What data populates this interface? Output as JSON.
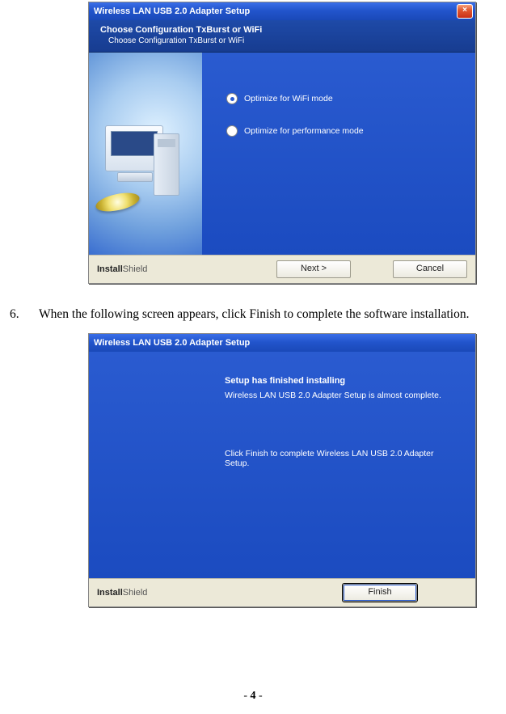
{
  "dialog1": {
    "title": "Wireless LAN USB 2.0 Adapter Setup",
    "header_title": "Choose Configuration TxBurst or WiFi",
    "header_sub": "Choose Configuration TxBurst or WiFi",
    "option1": "Optimize for WiFi mode",
    "option2": "Optimize for performance mode",
    "brand_a": "Install",
    "brand_b": "Shield",
    "next": "Next >",
    "cancel": "Cancel"
  },
  "step": {
    "number": "6.",
    "text": "When the following screen appears, click Finish to complete the software installation."
  },
  "dialog2": {
    "title": "Wireless LAN USB 2.0 Adapter Setup",
    "h1": "Setup has finished installing",
    "line1": "Wireless LAN USB 2.0 Adapter Setup is almost complete.",
    "line2": "Click Finish to complete Wireless LAN USB 2.0 Adapter Setup.",
    "brand_a": "Install",
    "brand_b": "Shield",
    "finish": "Finish"
  },
  "page_number_pre": "- ",
  "page_number": "4",
  "page_number_post": " -"
}
